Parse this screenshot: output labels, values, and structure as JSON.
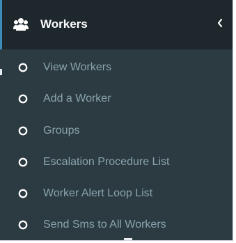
{
  "sidebar": {
    "header": {
      "title": "Workers",
      "icon": "users-icon",
      "toggle_icon": "chevron-left-icon"
    },
    "items": [
      {
        "label": "View Workers",
        "icon": "circle-o-icon"
      },
      {
        "label": "Add a Worker",
        "icon": "circle-o-icon"
      },
      {
        "label": "Groups",
        "icon": "circle-o-icon"
      },
      {
        "label": "Escalation Procedure List",
        "icon": "circle-o-icon"
      },
      {
        "label": "Worker Alert Loop List",
        "icon": "circle-o-icon"
      },
      {
        "label": "Send Sms to All Workers",
        "icon": "circle-o-icon"
      }
    ]
  },
  "colors": {
    "header_bg": "#1e282c",
    "menu_bg": "#2c3b41",
    "item_text": "#8aa4af",
    "header_text": "#ffffff",
    "accent": "#3c8dbc"
  }
}
